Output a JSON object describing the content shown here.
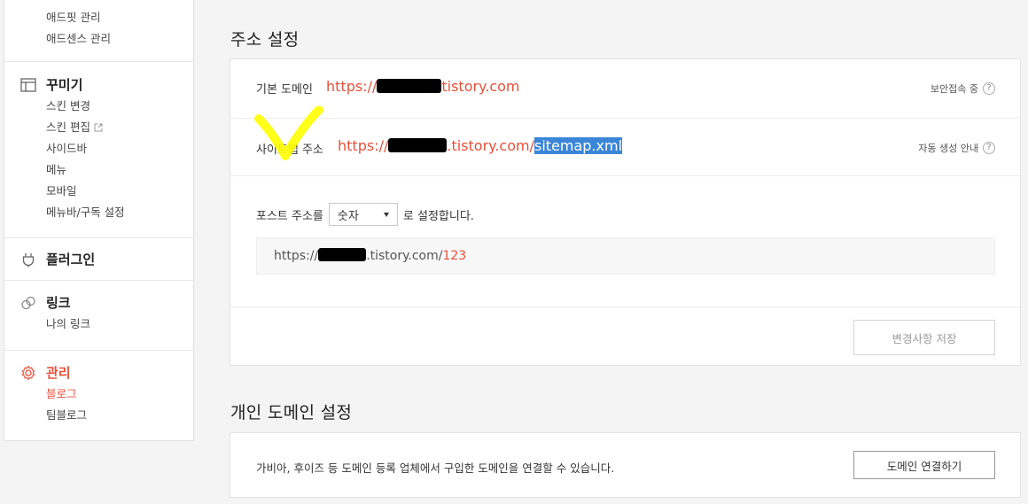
{
  "sidebar": {
    "adfit": "애드핏 관리",
    "adsense": "애드센스 관리",
    "decorate": {
      "title": "꾸미기",
      "items": [
        "스킨 변경",
        "스킨 편집",
        "사이드바",
        "메뉴",
        "모바일",
        "메뉴바/구독 설정"
      ]
    },
    "plugin": {
      "title": "플러그인"
    },
    "link": {
      "title": "링크",
      "items": [
        "나의 링크"
      ]
    },
    "manage": {
      "title": "관리",
      "items": [
        "블로그",
        "팀블로그"
      ]
    }
  },
  "address": {
    "heading": "주소 설정",
    "default_domain": {
      "label": "기본 도메인",
      "url_prefix": "https://",
      "url_suffix": "tistory.com",
      "help": "보안접속 중"
    },
    "sitemap": {
      "label": "사이트맵 주소",
      "url_prefix": "https://",
      "url_middle": ".tistory.com/",
      "url_selected": "sitemap.xml",
      "help": "자동 생성 안내"
    },
    "post": {
      "prefix": "포스트 주소를",
      "selected": "숫자",
      "suffix": "로 설정합니다.",
      "preview_prefix": "https://",
      "preview_middle": ".tistory.com/",
      "preview_num": "123"
    },
    "save_label": "변경사항 저장"
  },
  "personal": {
    "heading": "개인 도메인 설정",
    "desc": "가비아, 후이즈 등 도메인 등록 업체에서 구입한 도메인을 연결할 수 있습니다.",
    "button": "도메인 연결하기"
  },
  "colors": {
    "accent": "#e8503a",
    "highlight": "#ffff00",
    "selection": "#3a86d8"
  }
}
